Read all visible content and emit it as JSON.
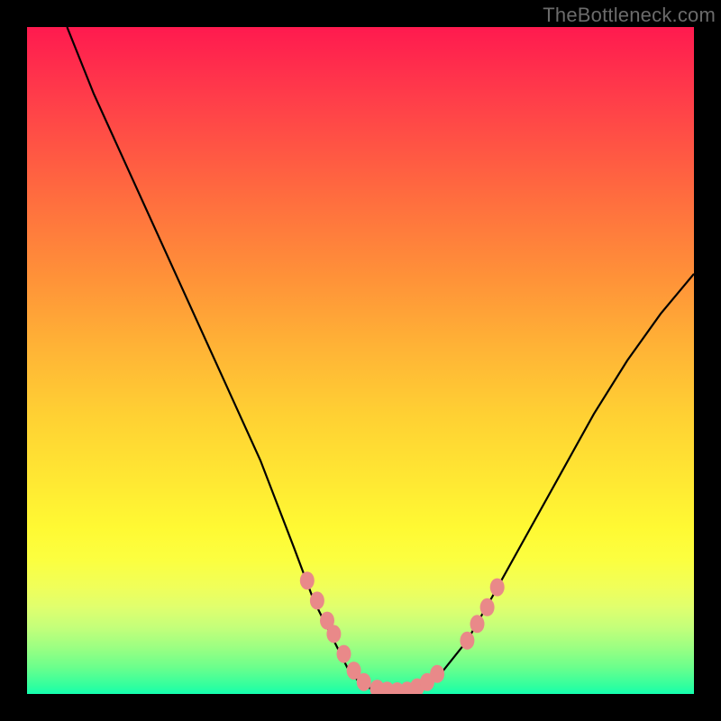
{
  "watermark": "TheBottleneck.com",
  "colors": {
    "frame": "#000000",
    "curve_stroke": "#000000",
    "marker_fill": "#e98989",
    "marker_stroke": "#d66f6f",
    "gradient_top": "#ff1a4f",
    "gradient_bottom": "#14ffb0"
  },
  "chart_data": {
    "type": "line",
    "title": "",
    "xlabel": "",
    "ylabel": "",
    "xlim": [
      0,
      100
    ],
    "ylim": [
      0,
      100
    ],
    "grid": false,
    "legend": false,
    "series": [
      {
        "name": "curve",
        "x": [
          6,
          10,
          15,
          20,
          25,
          30,
          35,
          40,
          43,
          46,
          48,
          50,
          52,
          54,
          56,
          58,
          62,
          66,
          70,
          75,
          80,
          85,
          90,
          95,
          100
        ],
        "y": [
          100,
          90,
          79,
          68,
          57,
          46,
          35,
          22,
          14,
          8,
          4,
          1.5,
          0.6,
          0.2,
          0.2,
          0.6,
          3,
          8,
          15,
          24,
          33,
          42,
          50,
          57,
          63
        ]
      }
    ],
    "markers": [
      {
        "x": 42,
        "y": 17
      },
      {
        "x": 43.5,
        "y": 14
      },
      {
        "x": 45,
        "y": 11
      },
      {
        "x": 46,
        "y": 9
      },
      {
        "x": 47.5,
        "y": 6
      },
      {
        "x": 49,
        "y": 3.5
      },
      {
        "x": 50.5,
        "y": 1.8
      },
      {
        "x": 52.5,
        "y": 0.8
      },
      {
        "x": 54,
        "y": 0.5
      },
      {
        "x": 55.5,
        "y": 0.4
      },
      {
        "x": 57,
        "y": 0.5
      },
      {
        "x": 58.5,
        "y": 1.0
      },
      {
        "x": 60,
        "y": 1.8
      },
      {
        "x": 61.5,
        "y": 3.0
      },
      {
        "x": 66,
        "y": 8
      },
      {
        "x": 67.5,
        "y": 10.5
      },
      {
        "x": 69,
        "y": 13
      },
      {
        "x": 70.5,
        "y": 16
      }
    ]
  }
}
